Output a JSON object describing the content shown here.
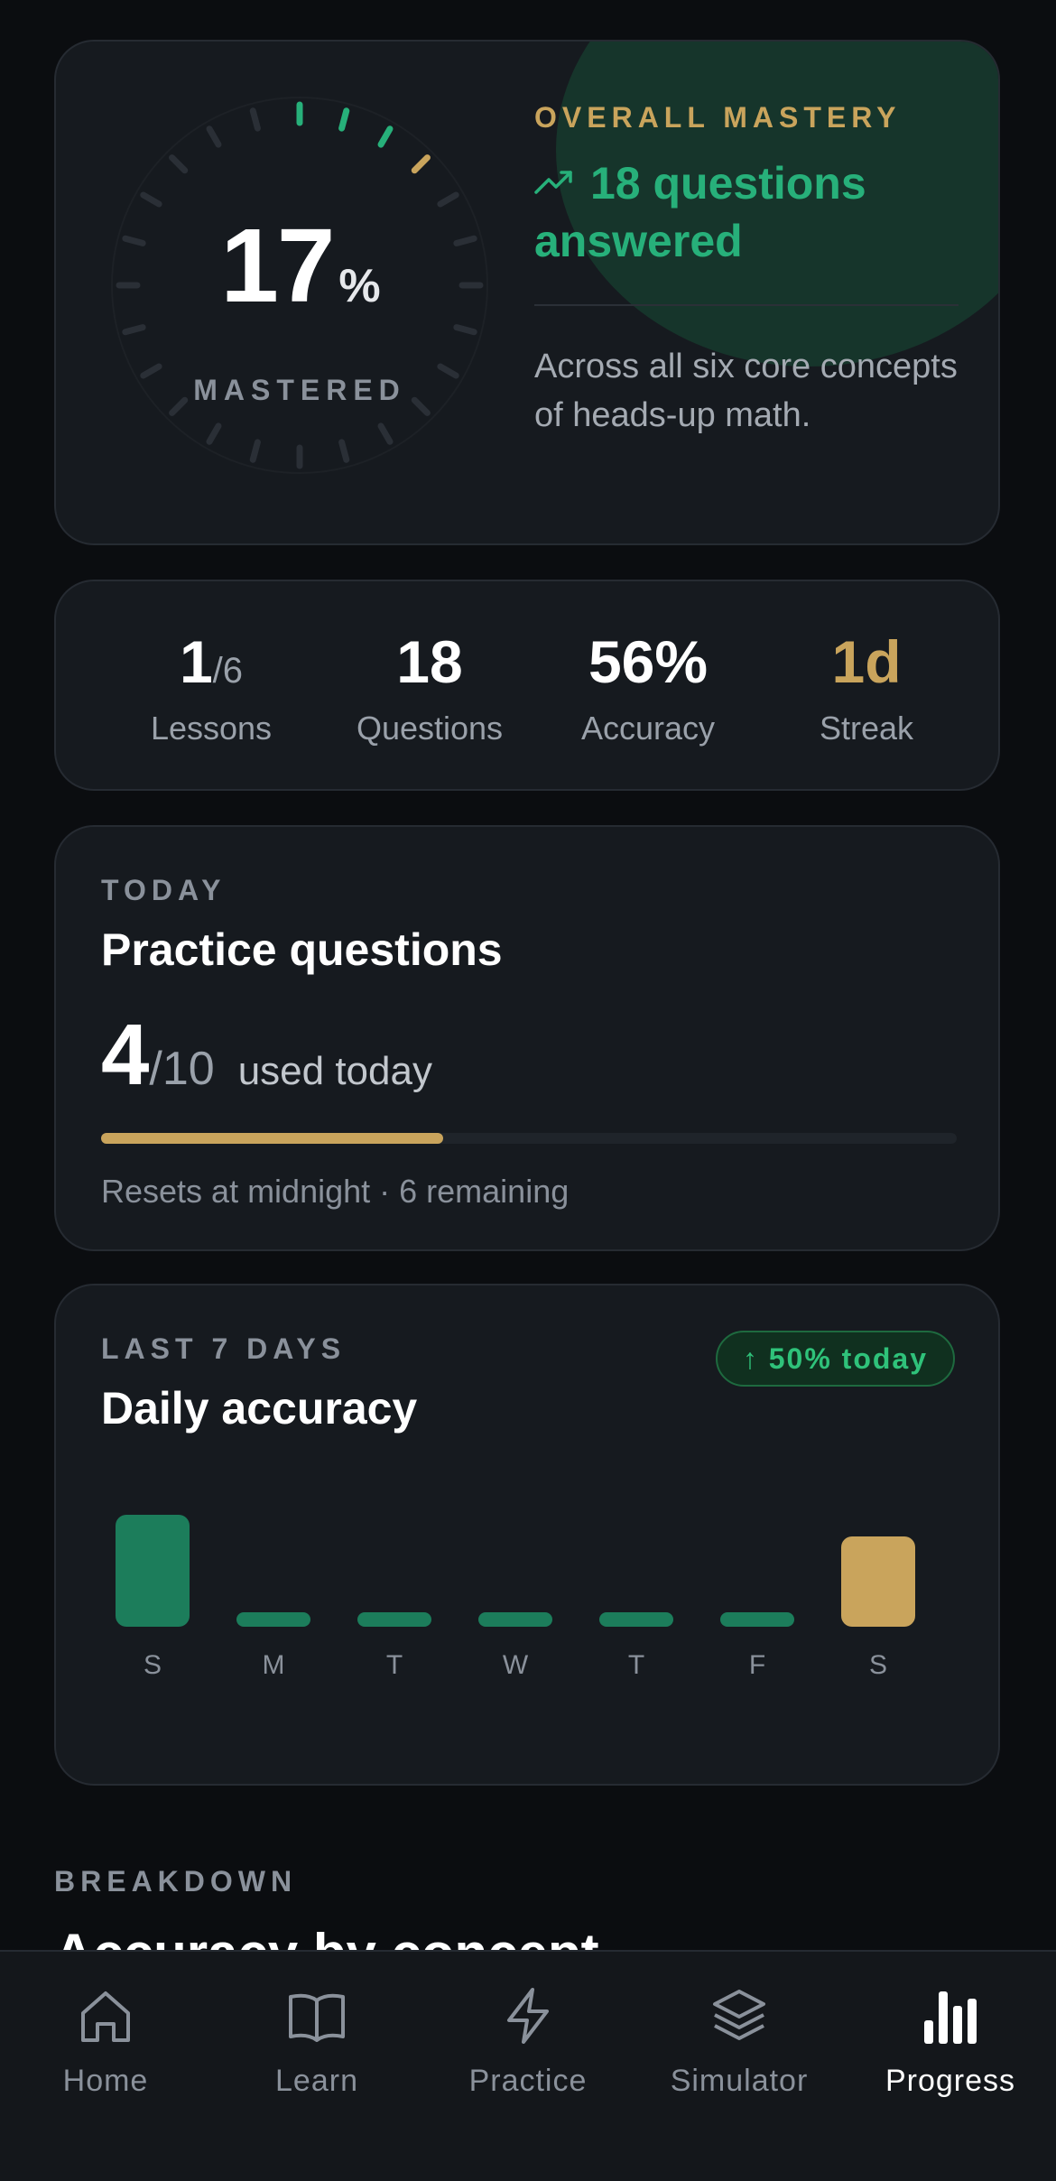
{
  "hero": {
    "percent": "17",
    "percent_unit": "%",
    "mastered_label": "MASTERED",
    "eyebrow": "OVERALL MASTERY",
    "answered_text": "18 questions answered",
    "description": "Across all six core concepts of heads-up math.",
    "trend_icon": "trending-up-icon",
    "colors": {
      "gold": "#c9a45c",
      "green": "#27b07a"
    },
    "dial": {
      "total_ticks": 24,
      "green_ticks": 3,
      "gold_ticks": 1
    }
  },
  "stats": [
    {
      "value": "1",
      "sub": "/6",
      "label": "Lessons",
      "accent": false
    },
    {
      "value": "18",
      "sub": "",
      "label": "Questions",
      "accent": false
    },
    {
      "value": "56%",
      "sub": "",
      "label": "Accuracy",
      "accent": false
    },
    {
      "value": "1d",
      "sub": "",
      "label": "Streak",
      "accent": true
    }
  ],
  "practice": {
    "eyebrow": "TODAY",
    "title": "Practice questions",
    "used": "4",
    "total": "/10",
    "used_label": "used today",
    "progress_fraction": 0.4,
    "reset_text": "Resets at midnight · 6 remaining"
  },
  "chart": {
    "eyebrow": "LAST 7 DAYS",
    "title": "Daily accuracy",
    "badge": "↑ 50% today"
  },
  "chart_data": {
    "type": "bar",
    "categories": [
      "S",
      "M",
      "T",
      "W",
      "T",
      "F",
      "S"
    ],
    "values": [
      62,
      0,
      0,
      0,
      0,
      0,
      50
    ],
    "highlight_index": 6,
    "colors": {
      "default": "#1c7d5b",
      "highlight": "#c9a45c"
    }
  },
  "breakdown": {
    "eyebrow": "BREAKDOWN",
    "title": "Accuracy by concept"
  },
  "nav": [
    {
      "label": "Home",
      "icon": "home-icon",
      "active": false
    },
    {
      "label": "Learn",
      "icon": "book-icon",
      "active": false
    },
    {
      "label": "Practice",
      "icon": "lightning-icon",
      "active": false
    },
    {
      "label": "Simulator",
      "icon": "layers-icon",
      "active": false
    },
    {
      "label": "Progress",
      "icon": "bar-chart-icon",
      "active": true
    }
  ]
}
